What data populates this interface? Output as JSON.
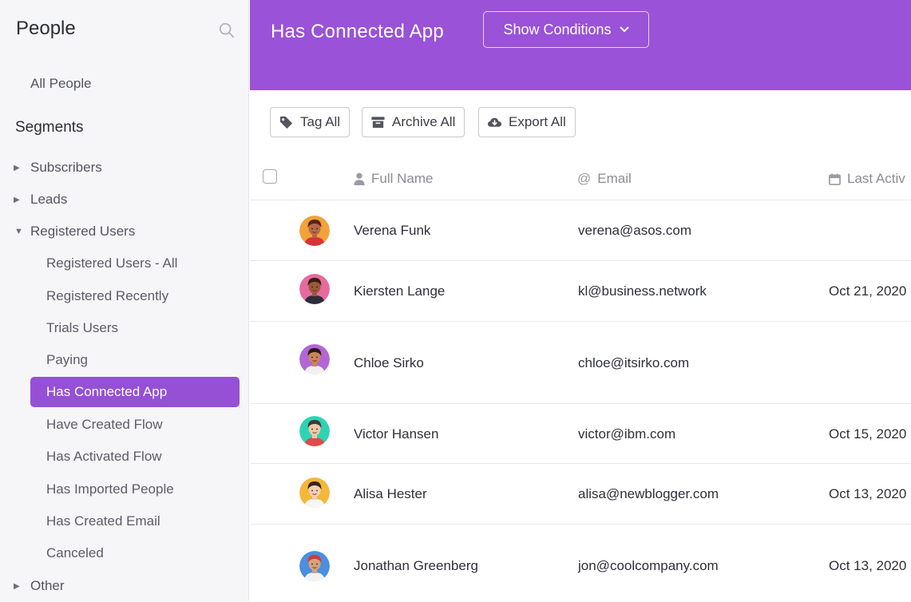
{
  "sidebar": {
    "title": "People",
    "all_people": "All People",
    "segments_heading": "Segments",
    "groups": [
      {
        "label": "Subscribers"
      },
      {
        "label": "Leads"
      },
      {
        "label": "Registered Users"
      },
      {
        "label": "Other"
      }
    ],
    "registered_items": [
      {
        "label": "Registered Users - All"
      },
      {
        "label": "Registered Recently"
      },
      {
        "label": "Trials Users"
      },
      {
        "label": "Paying"
      },
      {
        "label": "Has Connected App",
        "active": true
      },
      {
        "label": "Have Created Flow"
      },
      {
        "label": "Has Activated Flow"
      },
      {
        "label": "Has Imported People"
      },
      {
        "label": "Has Created Email"
      },
      {
        "label": "Canceled"
      }
    ]
  },
  "header": {
    "title": "Has Connected App",
    "conditions_button": "Show Conditions"
  },
  "toolbar": {
    "tag_all": "Tag All",
    "archive_all": "Archive All",
    "export_all": "Export All"
  },
  "table": {
    "columns": {
      "full_name": "Full Name",
      "email": "Email",
      "last_active": "Last Activ"
    },
    "rows": [
      {
        "name": "Verena Funk",
        "email": "verena@asos.com",
        "last_active": "",
        "avatar_bg": "#f2a23a",
        "skin": "#b8684a",
        "hair": "#5a2417",
        "shirt": "#d9323a"
      },
      {
        "name": "Kiersten Lange",
        "email": "kl@business.network",
        "last_active": "Oct 21, 2020",
        "avatar_bg": "#e66a9e",
        "skin": "#9a5a3a",
        "hair": "#3a1d12",
        "shirt": "#2c2c3a"
      },
      {
        "name": "Chloe Sirko",
        "email": "chloe@itsirko.com",
        "last_active": "",
        "avatar_bg": "#b266d6",
        "skin": "#c98556",
        "hair": "#2a1a14",
        "shirt": "#f0f0f0"
      },
      {
        "name": "Victor Hansen",
        "email": "victor@ibm.com",
        "last_active": "Oct 15, 2020",
        "avatar_bg": "#2fd3b4",
        "skin": "#f1c7a6",
        "hair": "#3b3b3b",
        "shirt": "#e04a4a"
      },
      {
        "name": "Alisa Hester",
        "email": "alisa@newblogger.com",
        "last_active": "Oct 13, 2020",
        "avatar_bg": "#f4b73a",
        "skin": "#f3d0b3",
        "hair": "#3a2418",
        "shirt": "#f6f6f6"
      },
      {
        "name": "Jonathan Greenberg",
        "email": "jon@coolcompany.com",
        "last_active": "Oct 13, 2020",
        "avatar_bg": "#4a8fe0",
        "skin": "#d7a27c",
        "hair": "#c6403c",
        "shirt": "#f2f2f2"
      }
    ]
  },
  "colors": {
    "accent": "#9a52d8",
    "active_item": "#9550d6"
  }
}
